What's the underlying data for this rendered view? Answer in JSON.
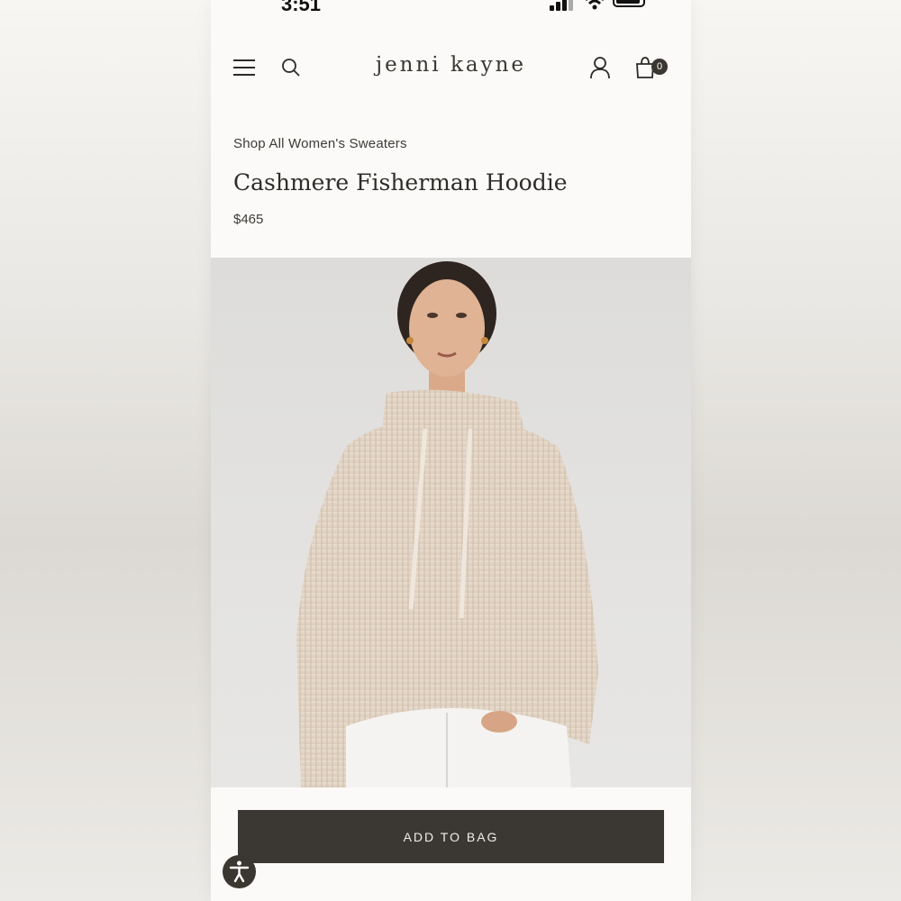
{
  "status_bar": {
    "time": "3:51"
  },
  "header": {
    "logo": "jenni kayne",
    "bag_count": "0"
  },
  "breadcrumb": "Shop All Women's Sweaters",
  "product": {
    "title": "Cashmere Fisherman Hoodie",
    "price": "$465"
  },
  "actions": {
    "add_to_bag_label": "ADD TO BAG"
  },
  "icons": [
    "menu-icon",
    "search-icon",
    "account-icon",
    "shopping-bag-icon",
    "accessibility-icon"
  ],
  "colors": {
    "button_bg": "#3b3733",
    "sweater": "#e4d8cb",
    "page_bg": "#fbfaf8"
  }
}
